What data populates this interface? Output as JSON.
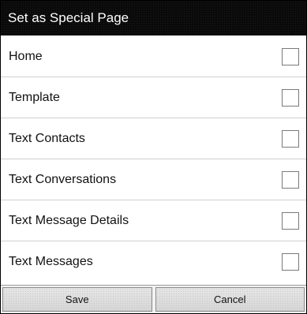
{
  "dialog": {
    "title": "Set as Special Page",
    "items": [
      {
        "label": "Home",
        "checked": false
      },
      {
        "label": "Template",
        "checked": false
      },
      {
        "label": "Text Contacts",
        "checked": false
      },
      {
        "label": "Text Conversations",
        "checked": false
      },
      {
        "label": "Text Message Details",
        "checked": false
      },
      {
        "label": "Text Messages",
        "checked": false
      }
    ],
    "save_label": "Save",
    "cancel_label": "Cancel"
  }
}
